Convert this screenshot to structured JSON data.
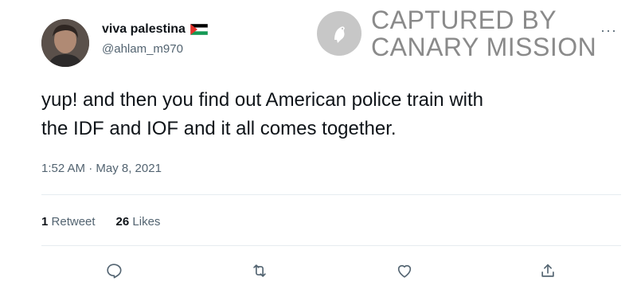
{
  "author": {
    "display_name": "viva palestina",
    "handle": "@ahlam_m970",
    "flag_icon": "palestine-flag-icon"
  },
  "watermark": {
    "line1": "CAPTURED BY",
    "line2": "CANARY MISSION",
    "color": "#8a8a8a"
  },
  "tweet": {
    "text_line1": "yup! and then you find out American police train with",
    "text_line2": "the IDF and IOF and it all comes together.",
    "timestamp": "1:52 AM · May 8, 2021"
  },
  "stats": {
    "retweets_count": "1",
    "retweets_label": "Retweet",
    "likes_count": "26",
    "likes_label": "Likes"
  },
  "actions": {
    "reply_icon": "reply-icon",
    "retweet_icon": "retweet-icon",
    "like_icon": "heart-icon",
    "share_icon": "share-icon"
  },
  "more_icon": "more-icon",
  "more_glyph": "···",
  "colors": {
    "text": "#0f1419",
    "secondary": "#536471",
    "divider": "#e6ecf0"
  }
}
